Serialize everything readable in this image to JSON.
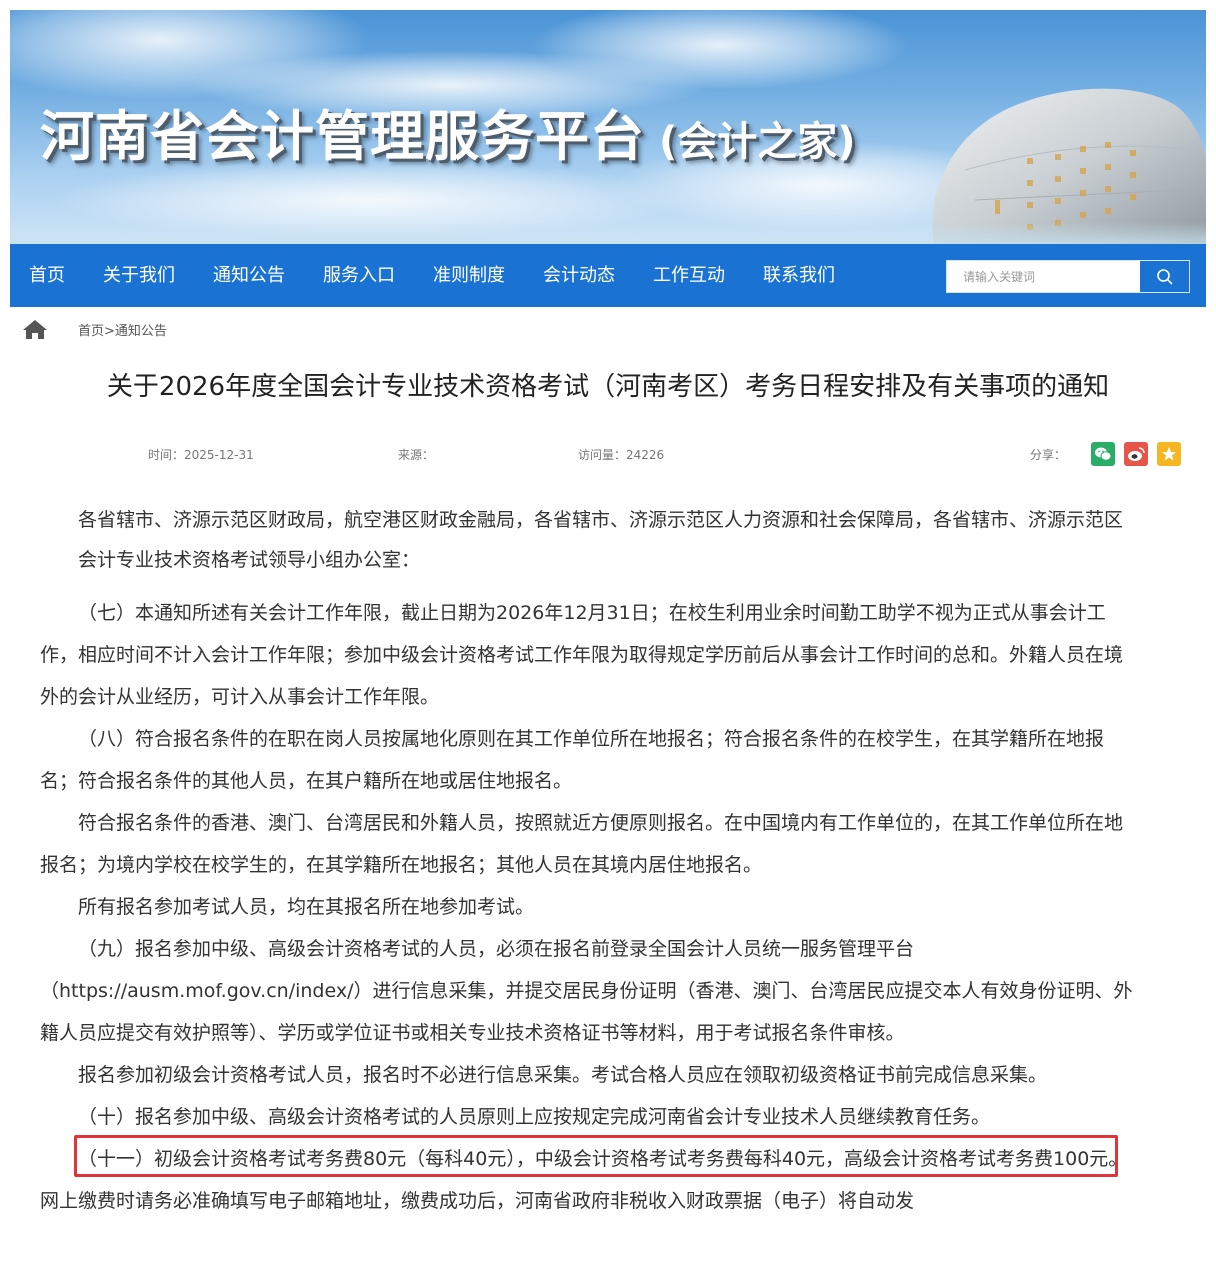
{
  "banner": {
    "title": "河南省会计管理服务平台",
    "subtitle": "(会计之家)"
  },
  "nav": {
    "items": [
      "首页",
      "关于我们",
      "通知公告",
      "服务入口",
      "准则制度",
      "会计动态",
      "工作互动",
      "联系我们"
    ],
    "search_placeholder": "请输入关键词"
  },
  "breadcrumb": {
    "text": "首页>通知公告"
  },
  "article": {
    "title": "关于2026年度全国会计专业技术资格考试（河南考区）考务日程安排及有关事项的通知",
    "meta": {
      "time": "时间：2025-12-31",
      "source": "来源：",
      "views": "访问量：24226",
      "share": "分享："
    },
    "salutation": "各省辖市、济源示范区财政局，航空港区财政金融局，各省辖市、济源示范区人力资源和社会保障局，各省辖市、济源示范区会计专业技术资格考试领导小组办公室：",
    "paragraphs": [
      "（七）本通知所述有关会计工作年限，截止日期为2026年12月31日；在校生利用业余时间勤工助学不视为正式从事会计工作，相应时间不计入会计工作年限；参加中级会计资格考试工作年限为取得规定学历前后从事会计工作时间的总和。外籍人员在境外的会计从业经历，可计入从事会计工作年限。",
      "（八）符合报名条件的在职在岗人员按属地化原则在其工作单位所在地报名；符合报名条件的在校学生，在其学籍所在地报名；符合报名条件的其他人员，在其户籍所在地或居住地报名。",
      "符合报名条件的香港、澳门、台湾居民和外籍人员，按照就近方便原则报名。在中国境内有工作单位的，在其工作单位所在地报名；为境内学校在校学生的，在其学籍所在地报名；其他人员在其境内居住地报名。",
      "所有报名参加考试人员，均在其报名所在地参加考试。",
      "（九）报名参加中级、高级会计资格考试的人员，必须在报名前登录全国会计人员统一服务管理平台（https://ausm.mof.gov.cn/index/）进行信息采集，并提交居民身份证明（香港、澳门、台湾居民应提交本人有效身份证明、外籍人员应提交有效护照等）、学历或学位证书或相关专业技术资格证书等材料，用于考试报名条件审核。",
      "报名参加初级会计资格考试人员，报名时不必进行信息采集。考试合格人员应在领取初级资格证书前完成信息采集。",
      "（十）报名参加中级、高级会计资格考试的人员原则上应按规定完成河南省会计专业技术人员继续教育任务。",
      "（十一）初级会计资格考试考务费80元（每科40元），中级会计资格考试考务费每科40元，高级会计资格考试考务费100元。网上缴费时请务必准确填写电子邮箱地址，缴费成功后，河南省政府非税收入财政票据（电子）将自动发"
    ]
  },
  "colors": {
    "nav_bg": "#1a73d3",
    "highlight_border": "#e0343a",
    "wechat": "#2aae67",
    "weibo": "#e6554a",
    "favorite": "#f5b623"
  }
}
